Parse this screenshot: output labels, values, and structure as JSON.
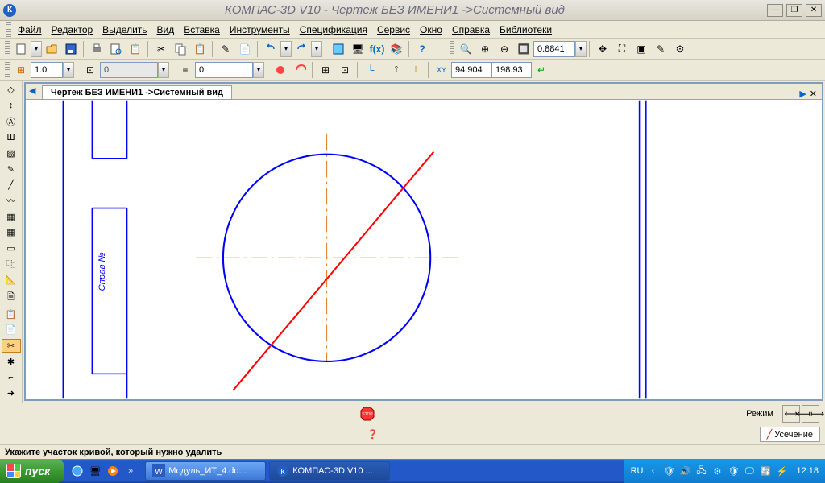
{
  "title": "КОМПАС-3D V10 - Чертеж БЕЗ ИМЕНИ1 ->Системный вид",
  "app_icon_text": "К",
  "menu": [
    "Файл",
    "Редактор",
    "Выделить",
    "Вид",
    "Вставка",
    "Инструменты",
    "Спецификация",
    "Сервис",
    "Окно",
    "Справка",
    "Библиотеки"
  ],
  "toolbar2": {
    "zoom_value": "0.8841",
    "coord_x": "94.904",
    "coord_y": "198.93"
  },
  "toolbar3": {
    "step_val": "1.0",
    "layer_val": "0",
    "style_val": "0"
  },
  "doc_tab": "Чертеж БЕЗ ИМЕНИ1 ->Системный вид",
  "prop": {
    "mode_label": "Режим",
    "tab": "Усечение"
  },
  "status": "Укажите участок кривой, который нужно удалить",
  "taskbar": {
    "start": "пуск",
    "tasks": [
      {
        "icon": "word",
        "label": "Модуль_ИТ_4.do..."
      },
      {
        "icon": "kompas",
        "label": "КОМПАС-3D V10 ..."
      }
    ],
    "lang": "RU",
    "clock": "12:18"
  }
}
